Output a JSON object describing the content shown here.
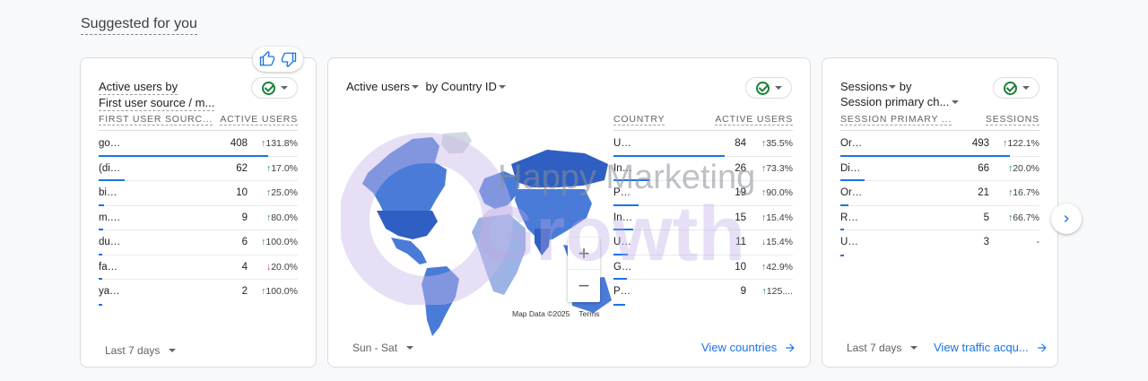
{
  "section_title": "Suggested for you",
  "feedback": {
    "like_icon": "thumb-up-icon",
    "dislike_icon": "thumb-down-icon"
  },
  "card1": {
    "title_line1": "Active users by",
    "title_line2": "First user source / m...",
    "col1": "FIRST USER SOURC...",
    "col2": "ACTIVE USERS",
    "rows": [
      {
        "label": "google / organic",
        "value": "408",
        "dir": "up",
        "change": "131.8%",
        "share": 0.85
      },
      {
        "label": "(direct) / (none)",
        "value": "62",
        "dir": "up",
        "change": "17.0%",
        "share": 0.13
      },
      {
        "label": "bing / organic",
        "value": "10",
        "dir": "up",
        "change": "25.0%",
        "share": 0.025
      },
      {
        "label": "m.facebook.com / re...",
        "value": "9",
        "dir": "up",
        "change": "80.0%",
        "share": 0.022
      },
      {
        "label": "duckduckgo / organic",
        "value": "6",
        "dir": "up",
        "change": "100.0%",
        "share": 0.015
      },
      {
        "label": "facebook.com / refer...",
        "value": "4",
        "dir": "down",
        "change": "20.0%",
        "share": 0.01
      },
      {
        "label": "yahoo / organic",
        "value": "2",
        "dir": "up",
        "change": "100.0%",
        "share": 0.005
      }
    ],
    "footer": "Last 7 days"
  },
  "card2": {
    "title_metric": "Active users",
    "title_by": "by Country ID",
    "col1": "COUNTRY",
    "col2": "ACTIVE USERS",
    "rows": [
      {
        "label": "United States",
        "value": "84",
        "dir": "up",
        "change": "35.5%",
        "share": 0.62
      },
      {
        "label": "India",
        "value": "26",
        "dir": "up",
        "change": "73.3%",
        "share": 0.2
      },
      {
        "label": "Philippines",
        "value": "19",
        "dir": "up",
        "change": "90.0%",
        "share": 0.14
      },
      {
        "label": "Indonesia",
        "value": "15",
        "dir": "up",
        "change": "15.4%",
        "share": 0.11
      },
      {
        "label": "United Kingdom",
        "value": "11",
        "dir": "down",
        "change": "15.4%",
        "share": 0.08
      },
      {
        "label": "Germany",
        "value": "10",
        "dir": "up",
        "change": "42.9%",
        "share": 0.075
      },
      {
        "label": "Pakistan",
        "value": "9",
        "dir": "up",
        "change": "125....",
        "share": 0.067
      }
    ],
    "zoom_in": "+",
    "zoom_out": "−",
    "map_credit": "Map Data ©2025",
    "map_terms": "Terms",
    "footer": "Sun - Sat",
    "link": "View countries"
  },
  "card3": {
    "title_metric": "Sessions",
    "title_by": "by",
    "title_line2": "Session primary ch...",
    "col1": "SESSION PRIMARY ...",
    "col2": "SESSIONS",
    "rows": [
      {
        "label": "Organic Search",
        "value": "493",
        "dir": "up",
        "change": "122.1%",
        "share": 0.85
      },
      {
        "label": "Direct",
        "value": "66",
        "dir": "up",
        "change": "20.0%",
        "share": 0.12
      },
      {
        "label": "Organic Social",
        "value": "21",
        "dir": "up",
        "change": "16.7%",
        "share": 0.04
      },
      {
        "label": "Referral",
        "value": "5",
        "dir": "up",
        "change": "66.7%",
        "share": 0.012
      },
      {
        "label": "Unassigned",
        "value": "3",
        "dir": "none",
        "change": "-",
        "share": 0.006
      }
    ],
    "footer": "Last 7 days",
    "link": "View traffic acqu..."
  },
  "watermark": {
    "line1": "Happy Marketing",
    "line2": "Growth"
  },
  "colors": {
    "accent": "#1a73e8",
    "up": "#188038",
    "down": "#d93025",
    "map_land": "#4a7bd8",
    "map_empty": "#d4d9e0"
  }
}
